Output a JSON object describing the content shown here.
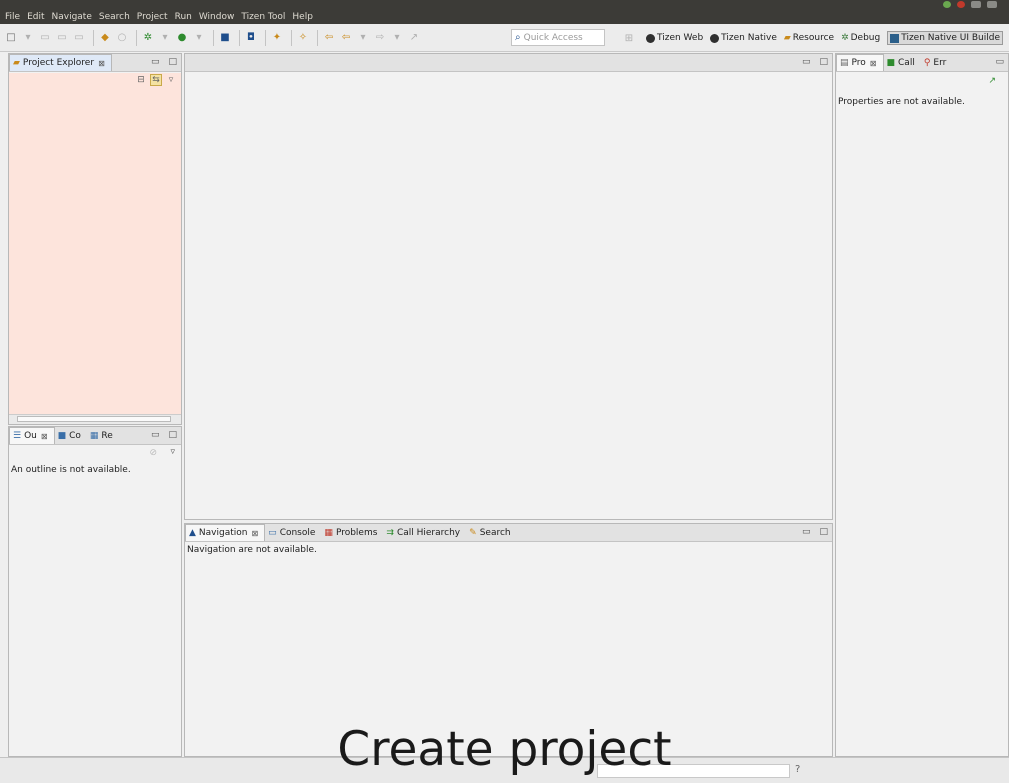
{
  "menu": [
    "File",
    "Edit",
    "Navigate",
    "Search",
    "Project",
    "Run",
    "Window",
    "Tizen Tool",
    "Help"
  ],
  "toolbar": {
    "quick_access_placeholder": "Quick Access",
    "perspectives": [
      {
        "label": "Tizen Web",
        "icon": "globe-icon"
      },
      {
        "label": "Tizen Native",
        "icon": "globe-icon"
      },
      {
        "label": "Resource",
        "icon": "folder-icon"
      },
      {
        "label": "Debug",
        "icon": "bug-icon"
      },
      {
        "label": "Tizen Native UI Builde",
        "icon": "ui-builder-icon",
        "active": true
      }
    ]
  },
  "project_explorer": {
    "tab_label": "Project Explorer",
    "close": "⊠"
  },
  "outline": {
    "tabs": [
      {
        "label": "Ou"
      },
      {
        "label": "Co"
      },
      {
        "label": "Re"
      }
    ],
    "message": "An outline is not available."
  },
  "navigation": {
    "tabs": [
      {
        "label": "Navigation"
      },
      {
        "label": "Console"
      },
      {
        "label": "Problems"
      },
      {
        "label": "Call Hierarchy"
      },
      {
        "label": "Search"
      }
    ],
    "message": "Navigation are not available."
  },
  "properties": {
    "tabs": [
      {
        "label": "Pro"
      },
      {
        "label": "Call"
      },
      {
        "label": "Err"
      }
    ],
    "message": "Properties are not available."
  },
  "caption": "Create project",
  "colors": {
    "menubar": "#3c3b37",
    "explorer_bg": "#fde4dc"
  }
}
